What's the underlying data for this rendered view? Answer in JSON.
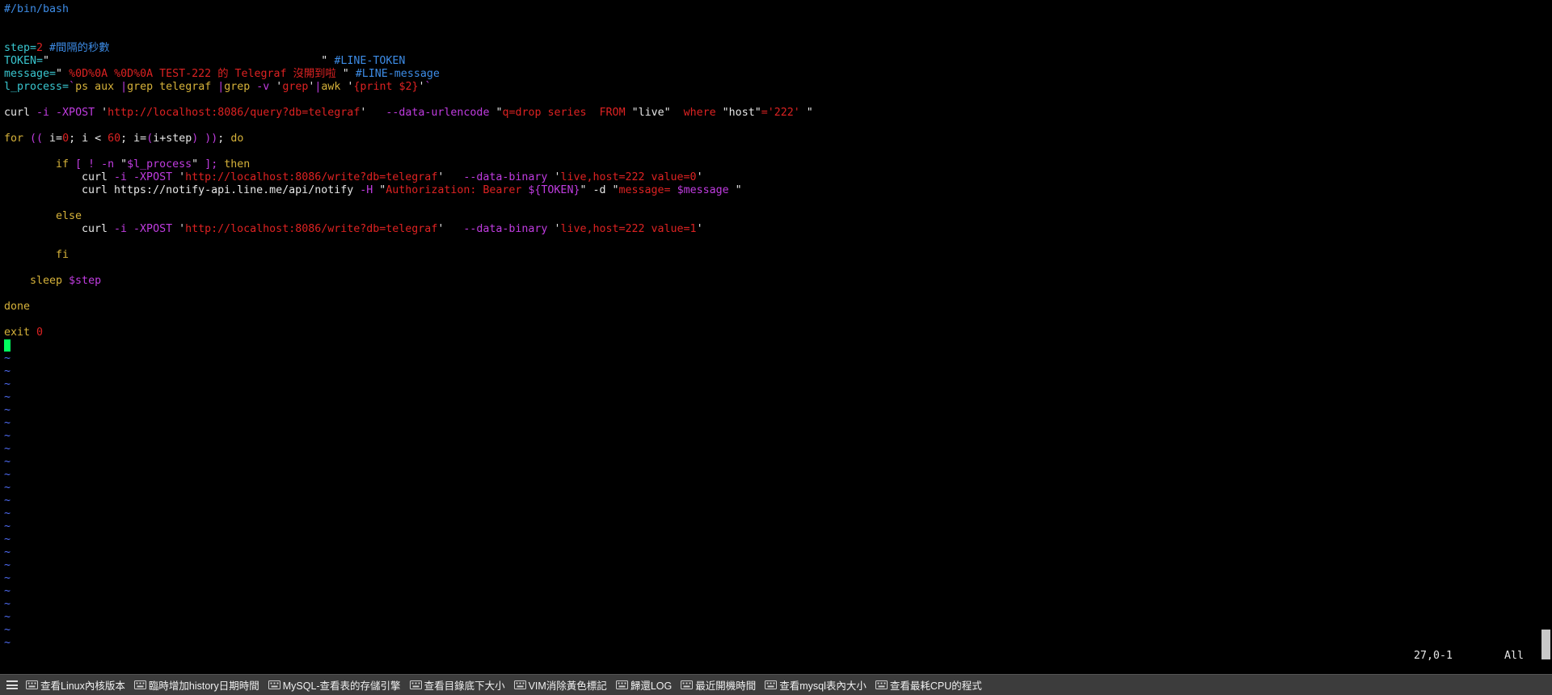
{
  "colors": {
    "background": "#000000",
    "text": "#e6e6e6",
    "comment": "#3d8ce6",
    "constant": "#dd2222",
    "keyword": "#d6b23a",
    "special": "#c03ce0",
    "variable": "#39c6cf",
    "cursor": "#00ff5f",
    "nontext": "#4f6cf5",
    "quickbar": "#3c3c3c"
  },
  "editor": {
    "lines": [
      {
        "row": 0,
        "indent": 0,
        "tokens": [
          {
            "t": "#/bin/bash",
            "c": "comment"
          }
        ]
      },
      {
        "row": 3,
        "indent": 0,
        "tokens": [
          {
            "t": "step=",
            "c": "variable"
          },
          {
            "t": "2",
            "c": "constant"
          },
          {
            "t": " #間隔的秒數",
            "c": "comment"
          }
        ]
      },
      {
        "row": 4,
        "indent": 0,
        "tokens": [
          {
            "t": "TOKEN=",
            "c": "variable"
          },
          {
            "t": "\"",
            "c": "text"
          },
          {
            "t": "                                          ",
            "c": "constant"
          },
          {
            "t": "\"",
            "c": "text"
          },
          {
            "t": " #LINE-TOKEN",
            "c": "comment"
          }
        ]
      },
      {
        "row": 5,
        "indent": 0,
        "tokens": [
          {
            "t": "message=",
            "c": "variable"
          },
          {
            "t": "\"",
            "c": "text"
          },
          {
            "t": " %0D%0A %0D%0A TEST-222 的 Telegraf 沒開到啦 ",
            "c": "constant"
          },
          {
            "t": "\"",
            "c": "text"
          },
          {
            "t": " #LINE-message",
            "c": "comment"
          }
        ]
      },
      {
        "row": 6,
        "indent": 0,
        "tokens": [
          {
            "t": "l_process=",
            "c": "variable"
          },
          {
            "t": "`",
            "c": "special"
          },
          {
            "t": "ps aux ",
            "c": "keyword"
          },
          {
            "t": "|",
            "c": "special"
          },
          {
            "t": "grep telegraf ",
            "c": "keyword"
          },
          {
            "t": "|",
            "c": "special"
          },
          {
            "t": "grep ",
            "c": "keyword"
          },
          {
            "t": "-v ",
            "c": "special"
          },
          {
            "t": "'",
            "c": "text"
          },
          {
            "t": "grep",
            "c": "constant"
          },
          {
            "t": "'",
            "c": "text"
          },
          {
            "t": "|",
            "c": "special"
          },
          {
            "t": "awk ",
            "c": "keyword"
          },
          {
            "t": "'",
            "c": "text"
          },
          {
            "t": "{print $2}",
            "c": "constant"
          },
          {
            "t": "'",
            "c": "text"
          },
          {
            "t": "`",
            "c": "special"
          }
        ]
      },
      {
        "row": 8,
        "indent": 0,
        "tokens": [
          {
            "t": "curl ",
            "c": "text"
          },
          {
            "t": "-i -XPOST ",
            "c": "special"
          },
          {
            "t": "'",
            "c": "text"
          },
          {
            "t": "http://localhost:8086/query?db=telegraf",
            "c": "constant"
          },
          {
            "t": "'",
            "c": "text"
          },
          {
            "t": "   --data-urlencode ",
            "c": "special"
          },
          {
            "t": "\"",
            "c": "text"
          },
          {
            "t": "q=drop series  FROM ",
            "c": "constant"
          },
          {
            "t": "\"live\"",
            "c": "text"
          },
          {
            "t": "  where ",
            "c": "constant"
          },
          {
            "t": "\"host\"",
            "c": "text"
          },
          {
            "t": "='222' ",
            "c": "constant"
          },
          {
            "t": "\"",
            "c": "text"
          }
        ]
      },
      {
        "row": 10,
        "indent": 0,
        "tokens": [
          {
            "t": "for ",
            "c": "keyword"
          },
          {
            "t": "((",
            "c": "special"
          },
          {
            "t": " i=",
            "c": "text"
          },
          {
            "t": "0",
            "c": "constant"
          },
          {
            "t": "; i < ",
            "c": "text"
          },
          {
            "t": "60",
            "c": "constant"
          },
          {
            "t": "; i=",
            "c": "text"
          },
          {
            "t": "(",
            "c": "special"
          },
          {
            "t": "i+step",
            "c": "text"
          },
          {
            "t": ")",
            "c": "special"
          },
          {
            "t": " ",
            "c": "text"
          },
          {
            "t": "))",
            "c": "special"
          },
          {
            "t": "; ",
            "c": "text"
          },
          {
            "t": "do",
            "c": "keyword"
          }
        ]
      },
      {
        "row": 12,
        "indent": 8,
        "tokens": [
          {
            "t": "if ",
            "c": "keyword"
          },
          {
            "t": "[",
            "c": "special"
          },
          {
            "t": " ! -n ",
            "c": "special"
          },
          {
            "t": "\"",
            "c": "text"
          },
          {
            "t": "$l_process",
            "c": "special"
          },
          {
            "t": "\"",
            "c": "text"
          },
          {
            "t": " ]; ",
            "c": "special"
          },
          {
            "t": "then",
            "c": "keyword"
          }
        ]
      },
      {
        "row": 13,
        "indent": 12,
        "tokens": [
          {
            "t": "curl ",
            "c": "text"
          },
          {
            "t": "-i -XPOST ",
            "c": "special"
          },
          {
            "t": "'",
            "c": "text"
          },
          {
            "t": "http://localhost:8086/write?db=telegraf",
            "c": "constant"
          },
          {
            "t": "'",
            "c": "text"
          },
          {
            "t": "   --data-binary ",
            "c": "special"
          },
          {
            "t": "'",
            "c": "text"
          },
          {
            "t": "live,host=222 value=0",
            "c": "constant"
          },
          {
            "t": "'",
            "c": "text"
          }
        ]
      },
      {
        "row": 14,
        "indent": 12,
        "tokens": [
          {
            "t": "curl https://notify-api.line.me/api/notify ",
            "c": "text"
          },
          {
            "t": "-H ",
            "c": "special"
          },
          {
            "t": "\"",
            "c": "text"
          },
          {
            "t": "Authorization: Bearer ",
            "c": "constant"
          },
          {
            "t": "${TOKEN}",
            "c": "special"
          },
          {
            "t": "\"",
            "c": "text"
          },
          {
            "t": " -d ",
            "c": "text"
          },
          {
            "t": "\"",
            "c": "text"
          },
          {
            "t": "message= ",
            "c": "constant"
          },
          {
            "t": "$message",
            "c": "special"
          },
          {
            "t": " \"",
            "c": "text"
          }
        ]
      },
      {
        "row": 16,
        "indent": 8,
        "tokens": [
          {
            "t": "else",
            "c": "keyword"
          }
        ]
      },
      {
        "row": 17,
        "indent": 12,
        "tokens": [
          {
            "t": "curl ",
            "c": "text"
          },
          {
            "t": "-i -XPOST ",
            "c": "special"
          },
          {
            "t": "'",
            "c": "text"
          },
          {
            "t": "http://localhost:8086/write?db=telegraf",
            "c": "constant"
          },
          {
            "t": "'",
            "c": "text"
          },
          {
            "t": "   --data-binary ",
            "c": "special"
          },
          {
            "t": "'",
            "c": "text"
          },
          {
            "t": "live,host=222 value=1",
            "c": "constant"
          },
          {
            "t": "'",
            "c": "text"
          }
        ]
      },
      {
        "row": 19,
        "indent": 8,
        "tokens": [
          {
            "t": "fi",
            "c": "keyword"
          }
        ]
      },
      {
        "row": 21,
        "indent": 4,
        "tokens": [
          {
            "t": "sleep ",
            "c": "keyword"
          },
          {
            "t": "$step",
            "c": "special"
          }
        ]
      },
      {
        "row": 23,
        "indent": 0,
        "tokens": [
          {
            "t": "done",
            "c": "keyword"
          }
        ]
      },
      {
        "row": 25,
        "indent": 0,
        "tokens": [
          {
            "t": "exit ",
            "c": "keyword"
          },
          {
            "t": "0",
            "c": "constant"
          }
        ]
      }
    ],
    "cursor_row": 26,
    "tilde_char": "~",
    "tilde_count": 23
  },
  "statusline": {
    "position": "27,0-1",
    "scroll": "All"
  },
  "quickbar": {
    "items": [
      {
        "label": "查看Linux內核版本"
      },
      {
        "label": "臨時增加history日期時間"
      },
      {
        "label": "MySQL-查看表的存儲引擎"
      },
      {
        "label": "查看目錄底下大小"
      },
      {
        "label": "VIM消除黃色標記"
      },
      {
        "label": "歸還LOG"
      },
      {
        "label": "最近開機時間"
      },
      {
        "label": "查看mysql表內大小"
      },
      {
        "label": "查看最耗CPU的程式"
      }
    ]
  }
}
